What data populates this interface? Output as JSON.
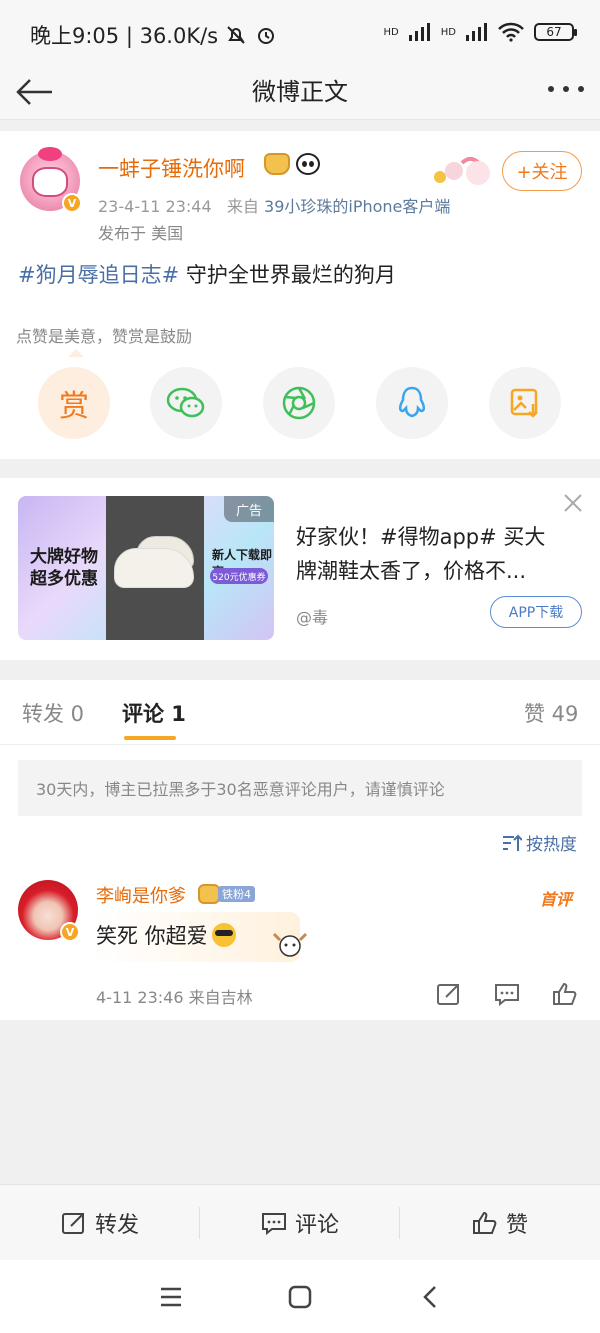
{
  "status_bar": {
    "time_speed": "晚上9:05 | 36.0K/s",
    "net_1": "HD",
    "net_2": "HD",
    "battery": "67"
  },
  "title_bar": {
    "title": "微博正文"
  },
  "post": {
    "username": "一蚌子锤洗你啊",
    "date": "23-4-11 23:44",
    "source_prefix": "来自",
    "source": "39小珍珠的iPhone客户端",
    "location": "发布于 美国",
    "follow_label": "+关注",
    "topic": "#狗月辱追日志#",
    "text": " 守护全世界最烂的狗月",
    "reward_hint": "点赞是美意，赞赏是鼓励",
    "reward_label": "赏"
  },
  "ad": {
    "image_left_text_1": "大牌好物",
    "image_left_text_2": "超多优惠",
    "image_right_text": "新人下载即享",
    "image_coupon": "520元优惠券",
    "tag": "广告",
    "text": "好家伙！#得物app# 买大牌潮鞋太香了，价格不...",
    "source": "@毒",
    "download_label": "APP下载"
  },
  "comments": {
    "tabs": [
      {
        "label": "转发 0"
      },
      {
        "label": "评论 1"
      },
      {
        "label": "赞 49"
      }
    ],
    "notice": "30天内，博主已拉黑多于30名恶意评论用户，请谨慎评论",
    "sort_label": "按热度",
    "items": [
      {
        "name": "李峋是你爹",
        "fan_badge": "铁粉4",
        "first_tag": "首评",
        "text": "笑死 你超爱",
        "meta": "4-11 23:46 来自吉林"
      }
    ]
  },
  "bottom_bar": {
    "repost": "转发",
    "comment": "评论",
    "like": "赞"
  },
  "colors": {
    "accent_orange": "#f17a1f",
    "link_blue": "#4a6fa5",
    "tab_underline": "#f5a623"
  }
}
